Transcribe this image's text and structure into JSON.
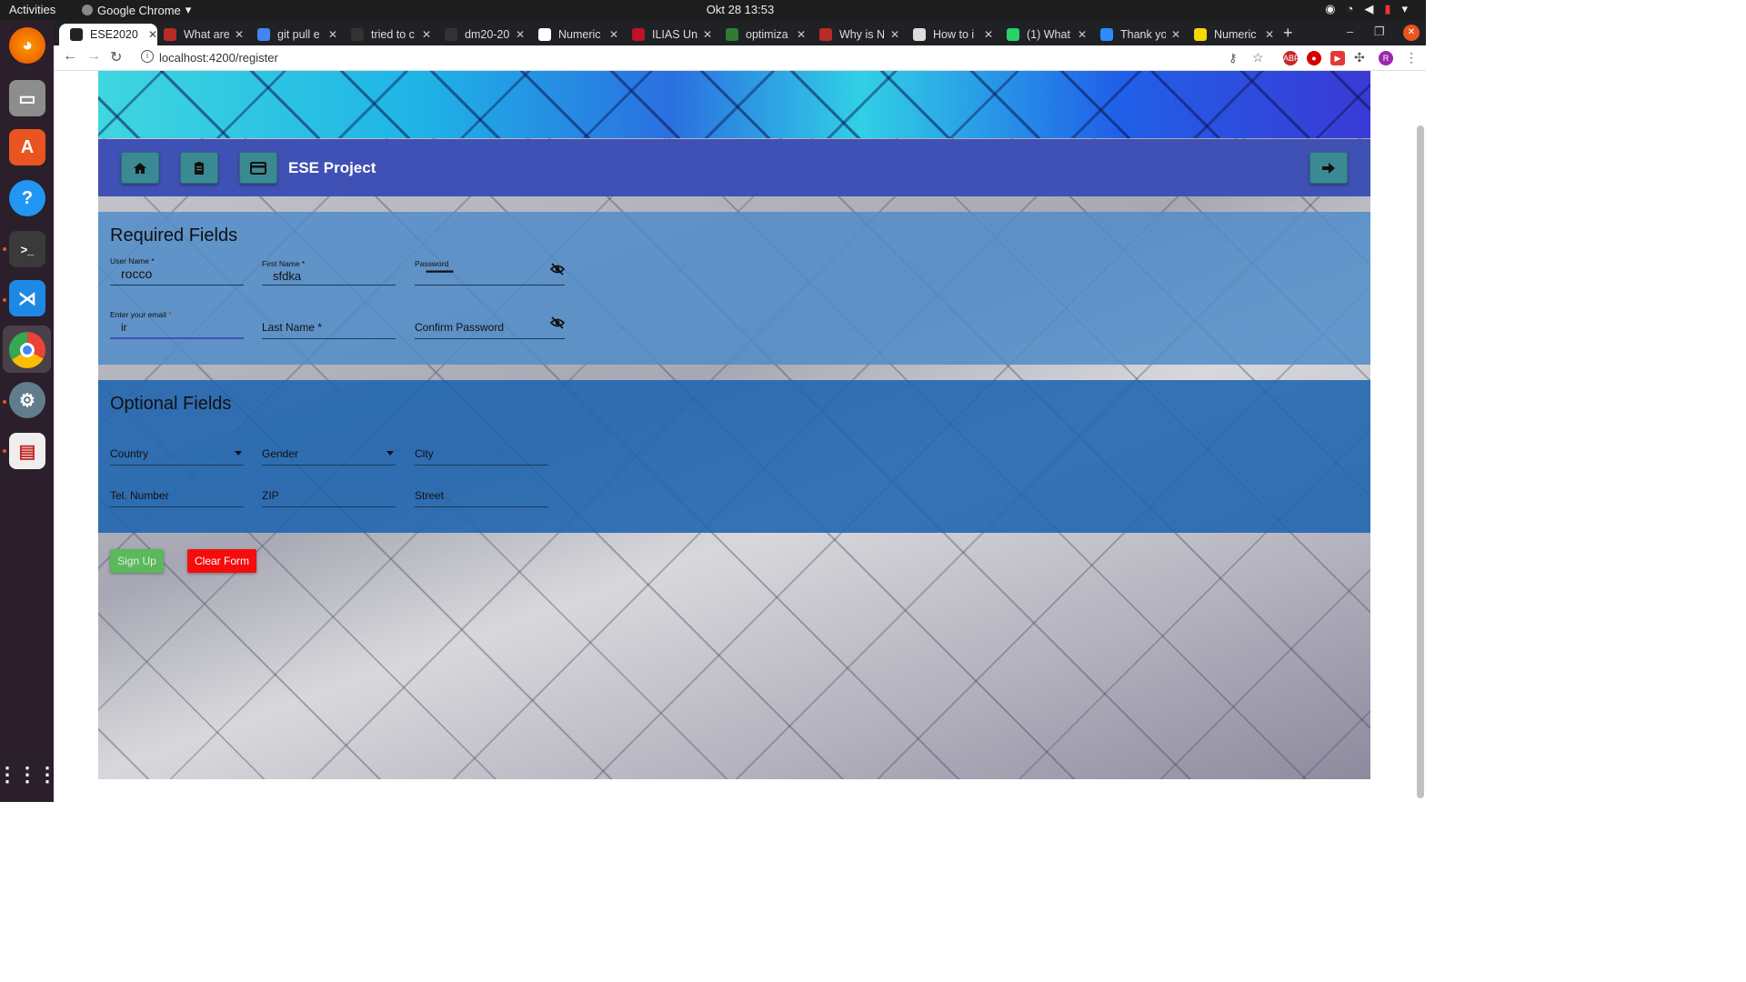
{
  "system": {
    "activities": "Activities",
    "app_name": "Google Chrome",
    "clock": "Okt 28  13:53"
  },
  "browser": {
    "tabs": [
      {
        "label": "ESE2020",
        "color": "#222222",
        "active": true
      },
      {
        "label": "What are",
        "color": "#b92b27"
      },
      {
        "label": "git pull e",
        "color": "#4285f4"
      },
      {
        "label": "tried to c",
        "color": "#333333"
      },
      {
        "label": "dm20-20",
        "color": "#333333"
      },
      {
        "label": "Numeric",
        "color": "#ffffff"
      },
      {
        "label": "ILIAS Uni",
        "color": "#c0102a"
      },
      {
        "label": "optimiza",
        "color": "#2e7d32"
      },
      {
        "label": "Why is N",
        "color": "#b92b27"
      },
      {
        "label": "How to i",
        "color": "#dddddd"
      },
      {
        "label": "(1) What",
        "color": "#25d366"
      },
      {
        "label": "Thank yo",
        "color": "#2d8cff"
      },
      {
        "label": "Numeric",
        "color": "#f5d800"
      }
    ],
    "url": "localhost:4200/register"
  },
  "page": {
    "title": "ESE Project",
    "required": {
      "heading": "Required Fields",
      "username": {
        "label": "User Name *",
        "value": "rocco"
      },
      "firstname": {
        "label": "First Name *",
        "value": "sfdka"
      },
      "password": {
        "label": "Password",
        "value": "••••••••••••"
      },
      "email": {
        "label": "Enter your email",
        "value": "ir"
      },
      "lastname": {
        "label": "Last Name *"
      },
      "confirm": {
        "label": "Confirm Password"
      }
    },
    "optional": {
      "heading": "Optional Fields",
      "country": "Country",
      "gender": "Gender",
      "city": "City",
      "tel": "Tel. Number",
      "zip": "ZIP",
      "street": "Street"
    },
    "buttons": {
      "signup": "Sign Up",
      "clear": "Clear Form"
    }
  },
  "colors": {
    "appbar": "#3f51b5",
    "signup": "#5cb85c",
    "clear": "#f50d0d"
  }
}
